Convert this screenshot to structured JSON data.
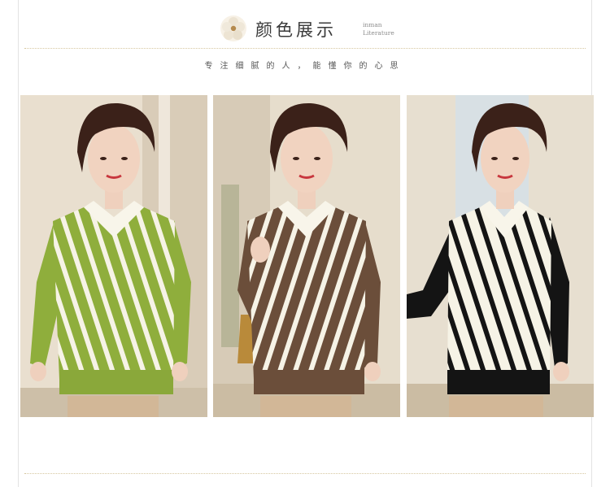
{
  "header": {
    "title": "颜色展示",
    "subtitle_line1": "inman",
    "subtitle_line2": "Literature",
    "tagline": "专注细腻的人，能懂你的心思"
  },
  "photos": [
    {
      "label": "green-white-striped-cardigan",
      "accent": "#8fae3c"
    },
    {
      "label": "brown-white-striped-cardigan",
      "accent": "#6b4e3a"
    },
    {
      "label": "black-white-striped-cardigan",
      "accent": "#141414"
    }
  ],
  "colors": {
    "background": "#ffffff",
    "divider": "#d6c7a0",
    "title": "#3a3a3a"
  }
}
